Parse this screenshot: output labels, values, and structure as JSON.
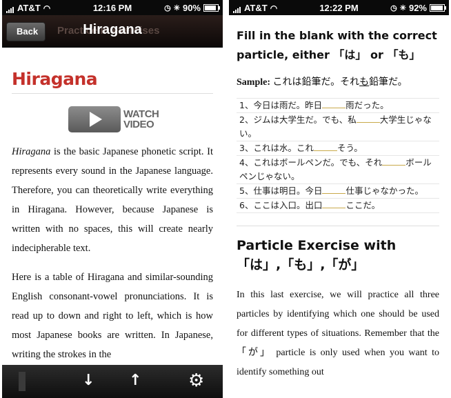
{
  "left": {
    "status": {
      "carrier": "AT&T",
      "time": "12:16 PM",
      "battery": "90%",
      "battery_level": 0.9
    },
    "nav": {
      "back_label": "Back",
      "title": "Hiragana",
      "ghost_text": "Practice in exercises"
    },
    "page": {
      "heading": "Hiragana",
      "watch_video": [
        "WATCH",
        "VIDEO"
      ],
      "paragraph1_term": "Hiragana",
      "paragraph1_rest": " is the basic Japanese phonetic script. It represents every sound in the Japanese language. Therefore, you can theoretically write everything in Hiragana. However, because Japanese is written with no spaces, this will create nearly indecipherable text.",
      "paragraph2": "Here is a table of Hiragana and similar-sounding English consonant-vowel pronunciations. It is read up to down and right to left, which is how most Japanese books are written. In Japanese, writing the strokes in the"
    },
    "tabbar": {
      "down_icon": "arrow-down-icon",
      "up_icon": "arrow-up-icon",
      "settings_icon": "gears-icon"
    }
  },
  "right": {
    "status": {
      "carrier": "AT&T",
      "time": "12:22 PM",
      "battery": "92%",
      "battery_level": 0.92
    },
    "page": {
      "heading": "Fill in the blank with the correct particle, either 「は」 or 「も」",
      "sample_label": "Sample:",
      "sample_pre": " これは鉛筆だ。それ",
      "sample_underlined": "も",
      "sample_post": "鉛筆だ。",
      "exercises": [
        {
          "pre": "1、今日は雨だ。昨日",
          "post": "雨だった。"
        },
        {
          "pre": "2、ジムは大学生だ。でも、私",
          "post": "大学生じゃない。"
        },
        {
          "pre": "3、これは水。これ",
          "post": "そう。"
        },
        {
          "pre": "4、これはボールペンだ。でも、それ",
          "post": "ボールペンじゃない。"
        },
        {
          "pre": "5、仕事は明日。今日",
          "post": "仕事じゃなかった。"
        },
        {
          "pre": "6、ここは入口。出口",
          "post": "ここだ。"
        }
      ],
      "heading2": "Particle Exercise with 「は」,「も」,「が」",
      "paragraph": "In this last exercise, we will practice all three particles by identifying which one should be used for different types of situations. Remember that the 「が」 particle is only used when you want to identify something out"
    }
  }
}
